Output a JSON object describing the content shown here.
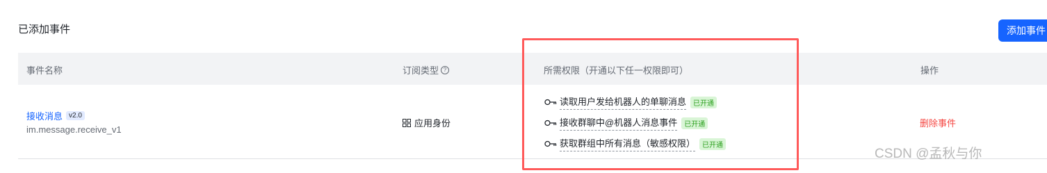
{
  "section": {
    "title": "已添加事件",
    "add_button": "添加事件"
  },
  "table": {
    "headers": {
      "name": "事件名称",
      "type": "订阅类型",
      "permission": "所需权限（开通以下任一权限即可）",
      "operation": "操作"
    },
    "rows": [
      {
        "name": "接收消息",
        "version": "v2.0",
        "event_id": "im.message.receive_v1",
        "subscription_type": "应用身份",
        "permissions": [
          {
            "label": "读取用户发给机器人的单聊消息",
            "status": "已开通"
          },
          {
            "label": "接收群聊中@机器人消息事件",
            "status": "已开通"
          },
          {
            "label": "获取群组中所有消息（敏感权限）",
            "status": "已开通"
          }
        ],
        "action": "删除事件"
      }
    ]
  },
  "icons": {
    "help": "help-circle-icon",
    "grid": "grid-icon",
    "key": "key-icon"
  },
  "colors": {
    "accent": "#1664ff",
    "danger": "#f54a45",
    "success": "#2ea121",
    "highlight": "#ff5a5a"
  },
  "watermark": "CSDN @孟秋与你"
}
